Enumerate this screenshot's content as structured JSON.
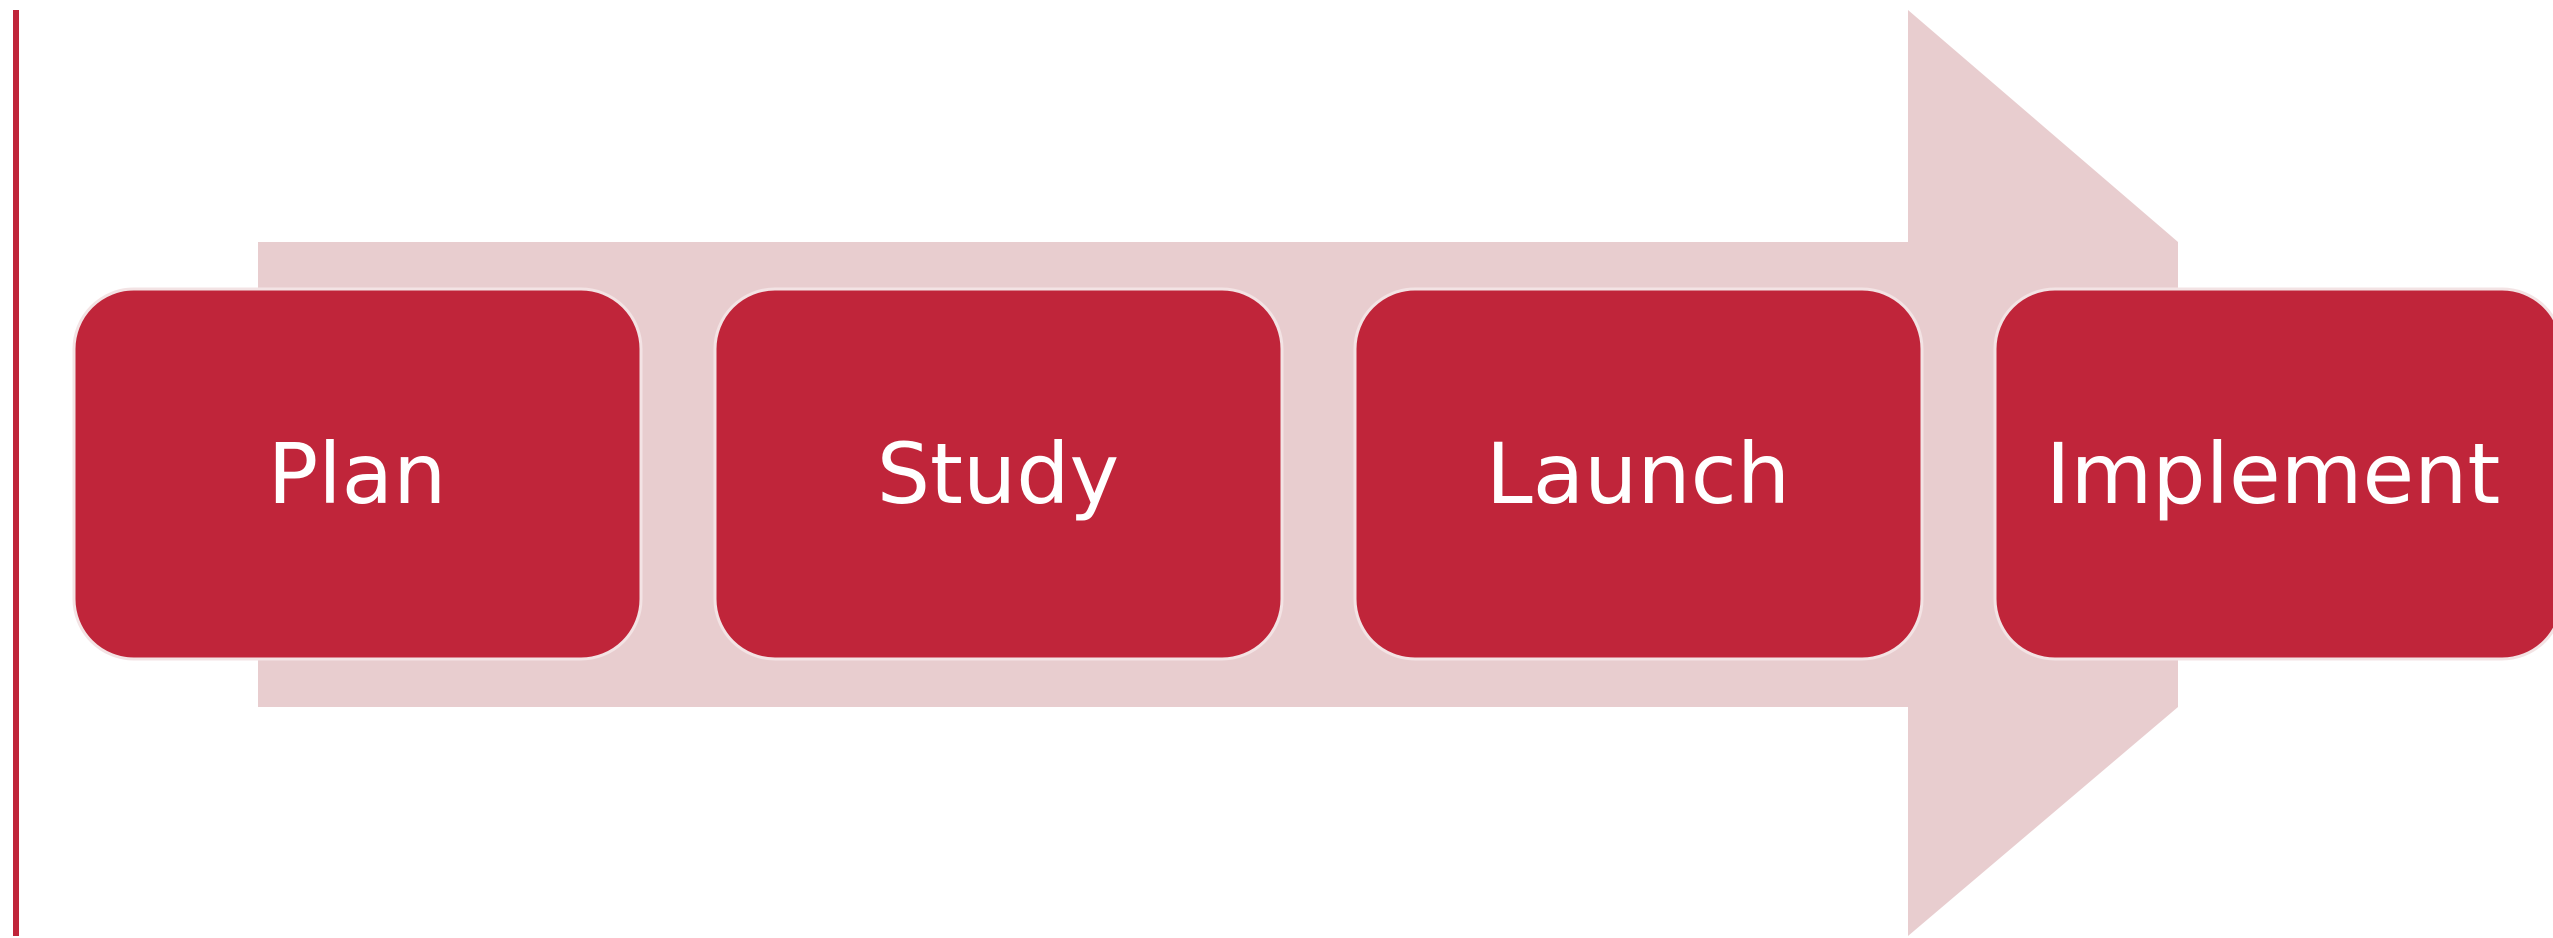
{
  "colors": {
    "accent": "#c0253a",
    "arrow": "#e8cdcf",
    "box": "#c0253a",
    "box_border": "#f3e3e4",
    "label": "#ffffff"
  },
  "steps": [
    {
      "label": "Plan"
    },
    {
      "label": "Study"
    },
    {
      "label": "Launch"
    },
    {
      "label": "Implement"
    }
  ]
}
